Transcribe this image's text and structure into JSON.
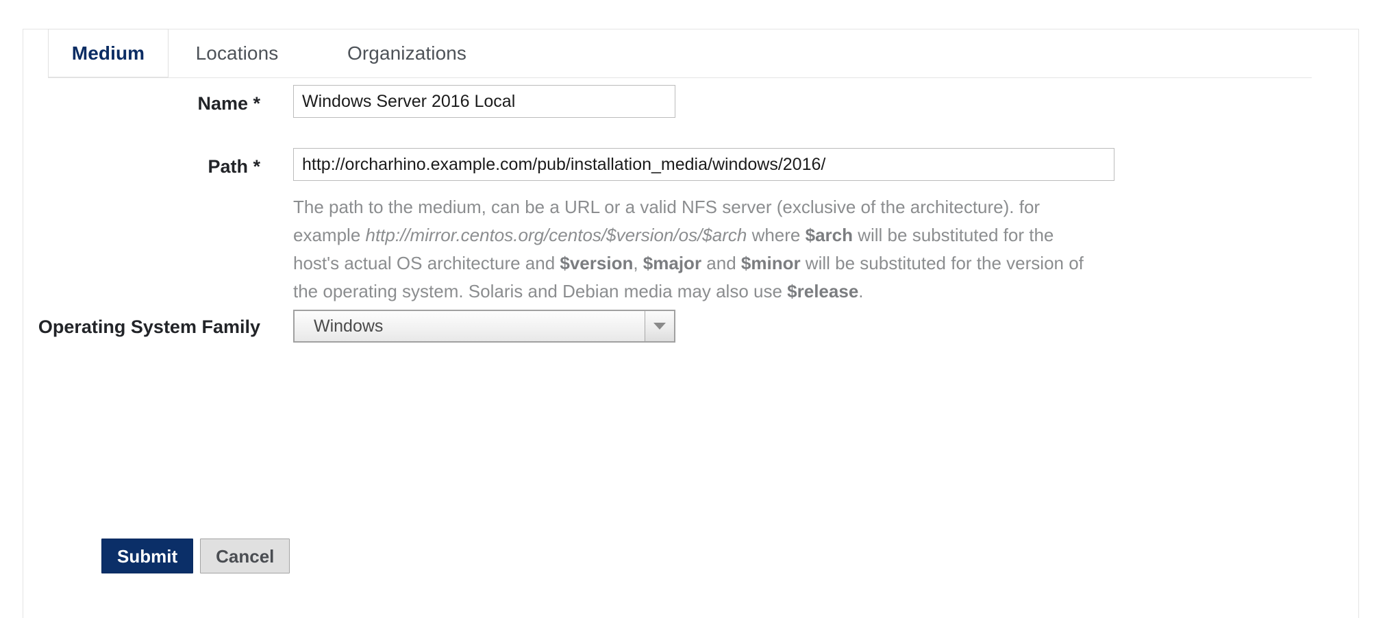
{
  "tabs": [
    {
      "id": "medium",
      "label": "Medium",
      "active": true
    },
    {
      "id": "locations",
      "label": "Locations",
      "active": false
    },
    {
      "id": "organizations",
      "label": "Organizations",
      "active": false
    }
  ],
  "form": {
    "name_field": {
      "label": "Name *",
      "value": "Windows Server 2016 Local",
      "placeholder": ""
    },
    "path_field": {
      "label": "Path *",
      "value": "http://orcharhino.example.com/pub/installation_media/windows/2016/",
      "placeholder": ""
    },
    "path_help": {
      "segment_1": "The path to the medium, can be a URL or a valid NFS server (exclusive of the architecture). for example ",
      "example_url": "http://mirror.centos.org/centos/$version/os/$arch",
      "segment_2": " where ",
      "var_arch": "$arch",
      "segment_3": " will be substituted for the host's actual OS architecture and ",
      "var_version": "$version",
      "segment_4": ", ",
      "var_major": "$major",
      "segment_5": " and ",
      "var_minor": "$minor",
      "segment_6": " will be substituted for the version of the operating system. Solaris and Debian media may also use ",
      "var_release": "$release",
      "segment_7": "."
    },
    "os_family_field": {
      "label": "Operating System Family",
      "selected": "Windows",
      "options": [
        "Windows"
      ]
    }
  },
  "actions": {
    "submit_label": "Submit",
    "cancel_label": "Cancel"
  },
  "colors": {
    "primary_button": "#0b2f68",
    "active_tab_text": "#0b2c63",
    "tab_text": "#4d5258",
    "help_text": "#8b8d8f",
    "border": "#e4e4e4"
  }
}
